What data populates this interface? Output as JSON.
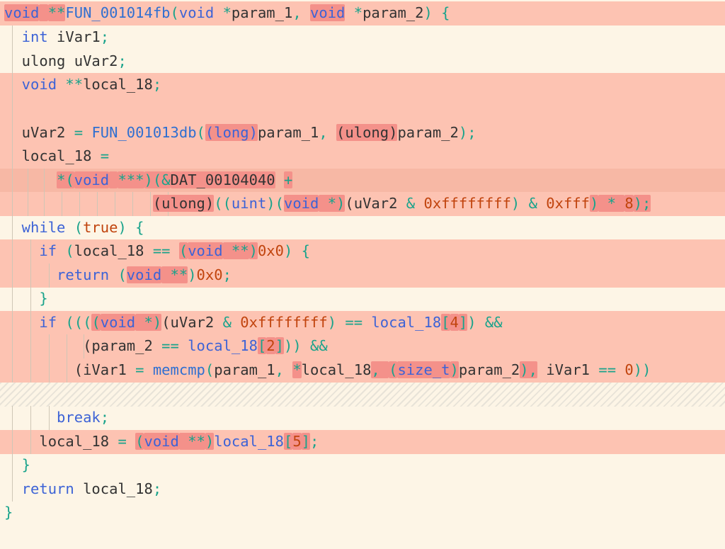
{
  "colors": {
    "background": "#fdf5e6",
    "highlight": "#fdc3b2",
    "highlight_box": "#f4918a",
    "keyword": "#3d63d6",
    "number": "#c1440e",
    "operator": "#19a38b"
  },
  "lines": [
    {
      "id": "l1",
      "segments": [
        {
          "t": "void",
          "c": "kw",
          "b": true
        },
        {
          "t": " ",
          "c": "plain",
          "b": true
        },
        {
          "t": "**",
          "c": "op",
          "b": true
        },
        {
          "t": "FUN_001014fb",
          "c": "fn"
        },
        {
          "t": "(",
          "c": "op"
        },
        {
          "t": "void",
          "c": "kw"
        },
        {
          "t": " ",
          "c": "plain"
        },
        {
          "t": "*",
          "c": "op"
        },
        {
          "t": "param_1",
          "c": "plain"
        },
        {
          "t": ", ",
          "c": "op"
        },
        {
          "t": "void",
          "c": "kw",
          "b": true
        },
        {
          "t": " ",
          "c": "plain"
        },
        {
          "t": "*",
          "c": "op"
        },
        {
          "t": "param_2",
          "c": "plain"
        },
        {
          "t": ") {",
          "c": "op"
        }
      ]
    },
    {
      "id": "l2",
      "segments": [
        {
          "t": "  int",
          "c": "kw"
        },
        {
          "t": " iVar1",
          "c": "plain"
        },
        {
          "t": ";",
          "c": "op"
        }
      ]
    },
    {
      "id": "l3",
      "segments": [
        {
          "t": "  ulong uVar2",
          "c": "plain"
        },
        {
          "t": ";",
          "c": "op"
        }
      ]
    },
    {
      "id": "l4",
      "segments": [
        {
          "t": "  void",
          "c": "kw"
        },
        {
          "t": " ",
          "c": "plain"
        },
        {
          "t": "**",
          "c": "op"
        },
        {
          "t": "local_18",
          "c": "plain"
        },
        {
          "t": ";",
          "c": "op"
        }
      ]
    },
    {
      "id": "l5",
      "segments": [
        {
          "t": "",
          "c": "plain"
        }
      ]
    },
    {
      "id": "l6",
      "segments": [
        {
          "t": "  uVar2 ",
          "c": "plain"
        },
        {
          "t": "= ",
          "c": "op"
        },
        {
          "t": "FUN_001013db",
          "c": "fn"
        },
        {
          "t": "(",
          "c": "op"
        },
        {
          "t": "(long)",
          "c": "kw",
          "b": true
        },
        {
          "t": "param_1",
          "c": "plain"
        },
        {
          "t": ", ",
          "c": "op"
        },
        {
          "t": "(ulong)",
          "c": "plain",
          "b": true
        },
        {
          "t": "param_2",
          "c": "plain"
        },
        {
          "t": ");",
          "c": "op"
        }
      ]
    },
    {
      "id": "l7",
      "segments": [
        {
          "t": "  local_18 ",
          "c": "plain"
        },
        {
          "t": "=",
          "c": "op"
        }
      ]
    },
    {
      "id": "l8",
      "segments": [
        {
          "t": "      ",
          "c": "plain"
        },
        {
          "t": "*(",
          "c": "op",
          "b": true
        },
        {
          "t": "void",
          "c": "kw",
          "b": true
        },
        {
          "t": " ",
          "c": "plain",
          "b": true
        },
        {
          "t": "***",
          "c": "op",
          "b": true
        },
        {
          "t": ")(&",
          "c": "op",
          "b": true
        },
        {
          "t": "DAT_00104040",
          "c": "plain",
          "b": true
        },
        {
          "t": " ",
          "c": "plain"
        },
        {
          "t": "+",
          "c": "op",
          "b": true
        }
      ]
    },
    {
      "id": "l9",
      "segments": [
        {
          "t": "                 ",
          "c": "plain"
        },
        {
          "t": "(ulong)",
          "c": "plain",
          "b": true
        },
        {
          "t": "((",
          "c": "op"
        },
        {
          "t": "uint",
          "c": "kw"
        },
        {
          "t": ")(",
          "c": "op"
        },
        {
          "t": "void",
          "c": "kw",
          "b": true
        },
        {
          "t": " *)",
          "c": "op",
          "b": true
        },
        {
          "t": "(uVar2 ",
          "c": "plain"
        },
        {
          "t": "& ",
          "c": "op"
        },
        {
          "t": "0xffffffff",
          "c": "num"
        },
        {
          "t": ") & ",
          "c": "op"
        },
        {
          "t": "0xfff",
          "c": "num"
        },
        {
          "t": ")",
          "c": "op",
          "b": true
        },
        {
          "t": " * ",
          "c": "op",
          "b": true
        },
        {
          "t": "8",
          "c": "num",
          "b": true
        },
        {
          "t": ");",
          "c": "op",
          "b": true
        }
      ]
    },
    {
      "id": "l10",
      "segments": [
        {
          "t": "  while",
          "c": "kw"
        },
        {
          "t": " (",
          "c": "op"
        },
        {
          "t": "true",
          "c": "kw2"
        },
        {
          "t": ") {",
          "c": "op"
        }
      ]
    },
    {
      "id": "l11",
      "segments": [
        {
          "t": "    if",
          "c": "kw"
        },
        {
          "t": " (",
          "c": "op"
        },
        {
          "t": "local_18 ",
          "c": "plain"
        },
        {
          "t": "== ",
          "c": "op"
        },
        {
          "t": "(",
          "c": "op",
          "b": true
        },
        {
          "t": "void",
          "c": "kw",
          "b": true
        },
        {
          "t": " **",
          "c": "op",
          "b": true
        },
        {
          "t": ")",
          "c": "op",
          "b": true
        },
        {
          "t": "0x0",
          "c": "num"
        },
        {
          "t": ") {",
          "c": "op"
        }
      ]
    },
    {
      "id": "l12",
      "segments": [
        {
          "t": "      return",
          "c": "kw"
        },
        {
          "t": " (",
          "c": "op"
        },
        {
          "t": "void",
          "c": "kw",
          "b": true
        },
        {
          "t": " **",
          "c": "op",
          "b": true
        },
        {
          "t": ")",
          "c": "op"
        },
        {
          "t": "0x0",
          "c": "num"
        },
        {
          "t": ";",
          "c": "op"
        }
      ]
    },
    {
      "id": "l13",
      "segments": [
        {
          "t": "    }",
          "c": "op"
        }
      ]
    },
    {
      "id": "l14",
      "segments": [
        {
          "t": "    if",
          "c": "kw"
        },
        {
          "t": " (((",
          "c": "op"
        },
        {
          "t": "(",
          "c": "op",
          "b": true
        },
        {
          "t": "void",
          "c": "kw",
          "b": true
        },
        {
          "t": " *)",
          "c": "op",
          "b": true
        },
        {
          "t": "(uVar2 ",
          "c": "plain"
        },
        {
          "t": "& ",
          "c": "op"
        },
        {
          "t": "0xffffffff",
          "c": "num"
        },
        {
          "t": ") == ",
          "c": "op"
        },
        {
          "t": "local_18",
          "c": "kw"
        },
        {
          "t": "[",
          "c": "op",
          "b": true
        },
        {
          "t": "4",
          "c": "num",
          "b": true
        },
        {
          "t": "]",
          "c": "op",
          "b": true
        },
        {
          "t": ") ",
          "c": "op"
        },
        {
          "t": "&&",
          "c": "op"
        }
      ]
    },
    {
      "id": "l15",
      "segments": [
        {
          "t": "         (param_2 ",
          "c": "plain"
        },
        {
          "t": "== ",
          "c": "op"
        },
        {
          "t": "local_18",
          "c": "kw"
        },
        {
          "t": "[",
          "c": "op",
          "b": true
        },
        {
          "t": "2",
          "c": "num",
          "b": true
        },
        {
          "t": "]",
          "c": "op",
          "b": true
        },
        {
          "t": ")) ",
          "c": "op"
        },
        {
          "t": "&&",
          "c": "op"
        }
      ]
    },
    {
      "id": "l16",
      "segments": [
        {
          "t": "        (iVar1 ",
          "c": "plain"
        },
        {
          "t": "= ",
          "c": "op"
        },
        {
          "t": "memcmp",
          "c": "fn"
        },
        {
          "t": "(",
          "c": "op"
        },
        {
          "t": "param_1",
          "c": "plain"
        },
        {
          "t": ", ",
          "c": "op"
        },
        {
          "t": "*",
          "c": "op",
          "b": true
        },
        {
          "t": "local_18",
          "c": "plain"
        },
        {
          "t": ", ",
          "c": "op",
          "b": true
        },
        {
          "t": "(",
          "c": "op",
          "b": true
        },
        {
          "t": "size_t",
          "c": "kw",
          "b": true
        },
        {
          "t": ")",
          "c": "op",
          "b": true
        },
        {
          "t": "param_2",
          "c": "plain"
        },
        {
          "t": "),",
          "c": "op",
          "b": true
        },
        {
          "t": " ",
          "c": "plain"
        },
        {
          "t": "iVar1 ",
          "c": "plain"
        },
        {
          "t": "== ",
          "c": "op"
        },
        {
          "t": "0",
          "c": "num"
        },
        {
          "t": "))",
          "c": "op"
        }
      ]
    },
    {
      "id": "l17",
      "segments": [
        {
          "t": "",
          "c": "plain"
        }
      ]
    },
    {
      "id": "l18",
      "segments": [
        {
          "t": "      break",
          "c": "kw"
        },
        {
          "t": ";",
          "c": "op"
        }
      ]
    },
    {
      "id": "l19",
      "segments": [
        {
          "t": "    local_18 ",
          "c": "plain"
        },
        {
          "t": "= ",
          "c": "op"
        },
        {
          "t": "(",
          "c": "op",
          "b": true
        },
        {
          "t": "void",
          "c": "kw",
          "b": true
        },
        {
          "t": " **",
          "c": "op",
          "b": true
        },
        {
          "t": ")",
          "c": "op",
          "b": true
        },
        {
          "t": "local_18",
          "c": "kw"
        },
        {
          "t": "[",
          "c": "op",
          "b": true
        },
        {
          "t": "5",
          "c": "num",
          "b": true
        },
        {
          "t": "]",
          "c": "op",
          "b": true
        },
        {
          "t": ";",
          "c": "op"
        }
      ]
    },
    {
      "id": "l20",
      "segments": [
        {
          "t": "  }",
          "c": "op"
        }
      ]
    },
    {
      "id": "l21",
      "segments": [
        {
          "t": "  return",
          "c": "kw"
        },
        {
          "t": " local_18",
          "c": "plain"
        },
        {
          "t": ";",
          "c": "op"
        }
      ]
    },
    {
      "id": "l22",
      "segments": [
        {
          "t": "}",
          "c": "op"
        }
      ]
    }
  ]
}
